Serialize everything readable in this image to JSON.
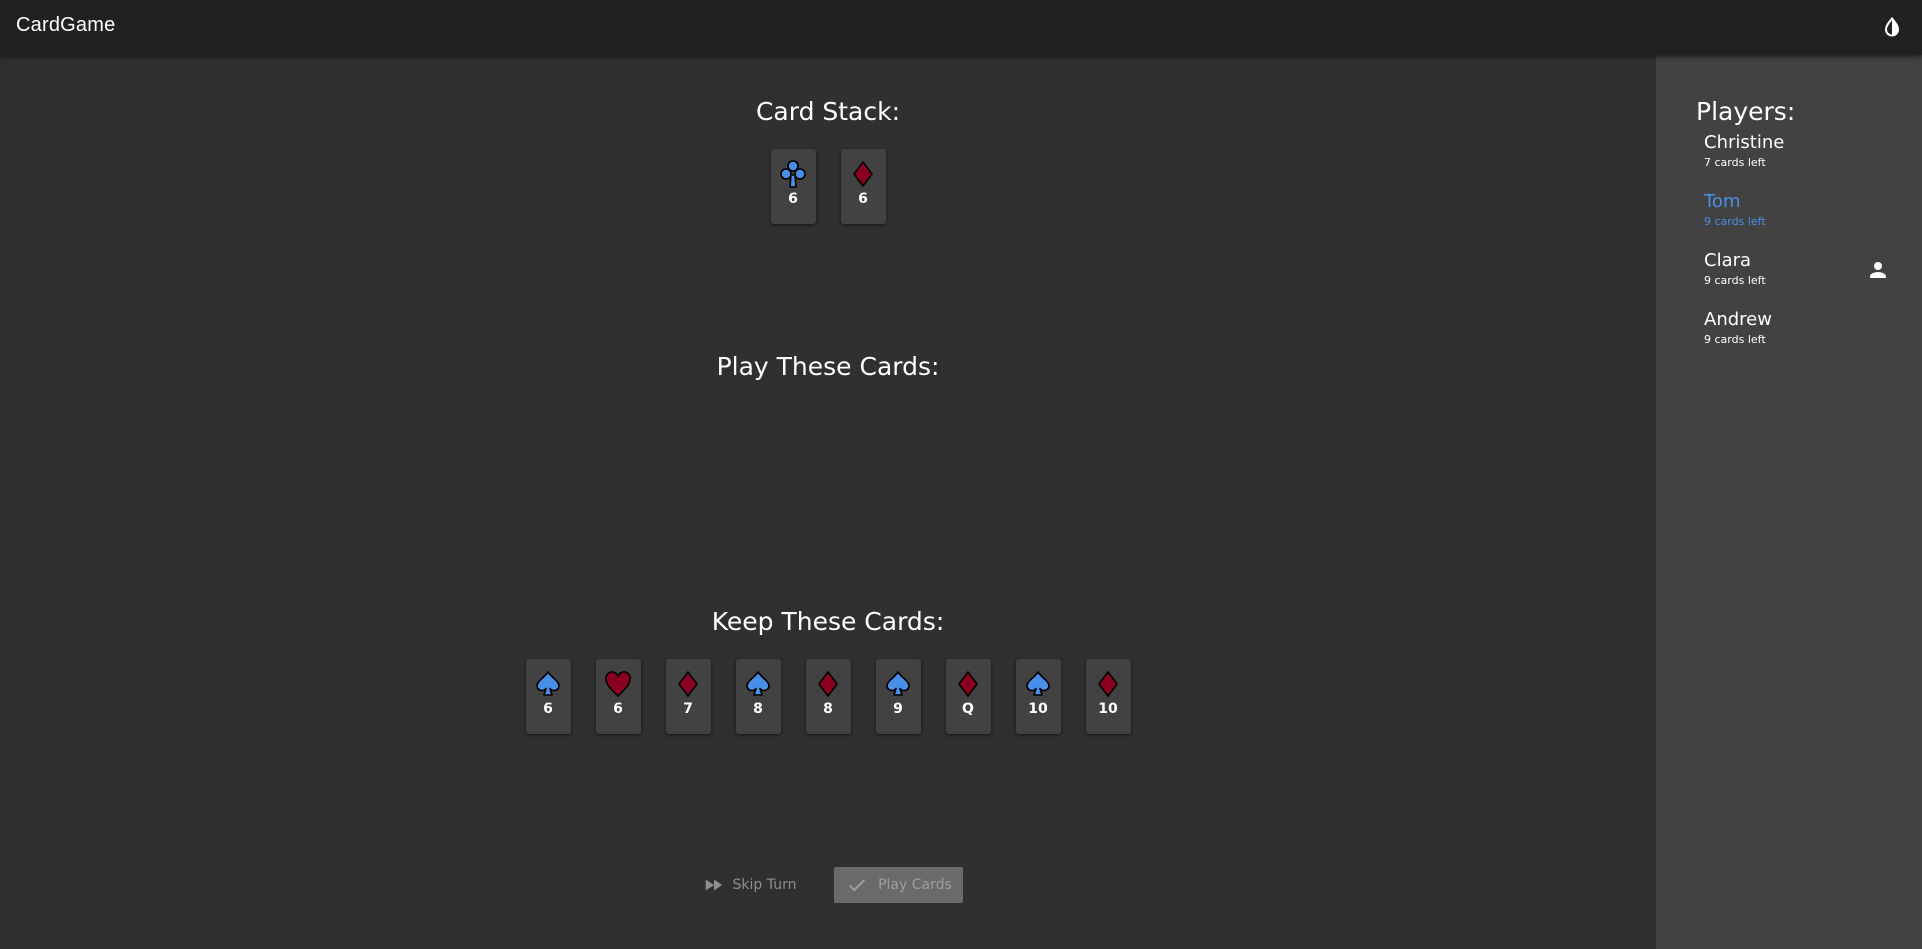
{
  "app": {
    "title": "CardGame"
  },
  "icons": {
    "theme_toggle": "contrast-icon",
    "current_player": "person-icon",
    "skip": "fast-forward-icon",
    "play": "check-icon"
  },
  "colors": {
    "spade_club": "#4a8fe7",
    "heart_diamond": "#8b0020",
    "active_player": "#4a8fe7",
    "card_bg": "#424242"
  },
  "stack": {
    "title": "Card Stack:",
    "cards": [
      {
        "suit": "club",
        "value": "6"
      },
      {
        "suit": "diamond",
        "value": "6"
      }
    ]
  },
  "play": {
    "title": "Play These Cards:",
    "cards": []
  },
  "keep": {
    "title": "Keep These Cards:",
    "cards": [
      {
        "suit": "spade",
        "value": "6"
      },
      {
        "suit": "heart",
        "value": "6"
      },
      {
        "suit": "diamond",
        "value": "7"
      },
      {
        "suit": "spade",
        "value": "8"
      },
      {
        "suit": "diamond",
        "value": "8"
      },
      {
        "suit": "spade",
        "value": "9"
      },
      {
        "suit": "diamond",
        "value": "Q"
      },
      {
        "suit": "spade",
        "value": "10"
      },
      {
        "suit": "diamond",
        "value": "10"
      }
    ]
  },
  "actions": {
    "skip_label": "Skip Turn",
    "play_label": "Play Cards"
  },
  "players": {
    "title": "Players:",
    "list": [
      {
        "name": "Christine",
        "cards_left": "7 cards left",
        "active": false,
        "is_you": false
      },
      {
        "name": "Tom",
        "cards_left": "9 cards left",
        "active": true,
        "is_you": false
      },
      {
        "name": "Clara",
        "cards_left": "9 cards left",
        "active": false,
        "is_you": true
      },
      {
        "name": "Andrew",
        "cards_left": "9 cards left",
        "active": false,
        "is_you": false
      }
    ]
  }
}
